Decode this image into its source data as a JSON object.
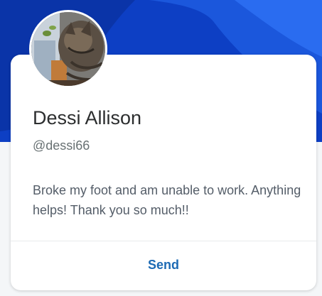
{
  "profile": {
    "name": "Dessi Allison",
    "handle": "@dessi66",
    "note": "Broke my foot and am unable to work. Anything helps! Thank you so much!!",
    "avatar_icon": "cat-photo"
  },
  "actions": {
    "send_label": "Send"
  },
  "colors": {
    "hero_dark": "#0b3bbf",
    "hero_light": "#1e63e8",
    "link": "#1c6ab4",
    "name_text": "#2c2e2f",
    "muted_text": "#687173"
  }
}
